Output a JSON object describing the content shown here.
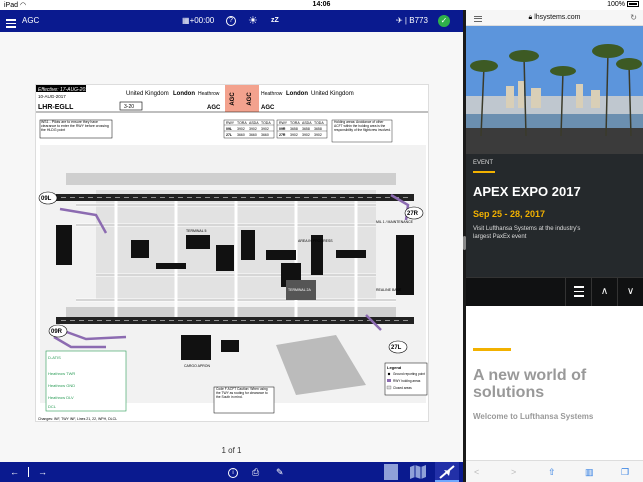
{
  "status_bar": {
    "device": "iPad",
    "wifi_icon": "wifi-icon",
    "time": "14:06",
    "battery": "100%"
  },
  "left_app": {
    "top_bar": {
      "title": "AGC",
      "time_offset": "+00:00",
      "flight": "B773"
    },
    "chart": {
      "effective": "Effective: 17-AUG-2017",
      "date": "10-AUG-2017",
      "airport_code": "LHR-EGLL",
      "country_left": "United Kingdom",
      "city_left": "London",
      "airport_left": "Heathrow",
      "airport_right": "Heathrow",
      "city_right": "London",
      "country_right": "United Kingdom",
      "chart_number": "3-20",
      "chart_type": "AGC",
      "badge_1": "AGC",
      "badge_2": "AGC",
      "note_box": "WS1 - Pilots are to ensure they have clearance to enter the RWY before crossing the HLDG point",
      "holding_note": "Holding areas: Avoidance of other ACFT within the holding area is the responsibility of the flightcrew involved.",
      "runway_table": {
        "headers": [
          "RWY",
          "TORA",
          "ASDA",
          "TODA"
        ],
        "rows": [
          [
            "09L",
            "3902",
            "3902",
            "3902"
          ],
          [
            "27L",
            "3660",
            "3660",
            "3660"
          ],
          [
            "09R",
            "3658",
            "3658",
            "3658"
          ],
          [
            "27R",
            "3902",
            "3902",
            "3902"
          ]
        ]
      },
      "runway_labels": [
        "09L",
        "27R",
        "09R",
        "27L"
      ],
      "terminal_labels": [
        "TERMINAL 2A",
        "TERMINAL 5",
        "CARGO APRON",
        "AREA IN PROGRESS",
        "REALINE BASE",
        "MIL 1 / MAINTENANCE"
      ],
      "legend_title": "Legend",
      "legend_items": [
        "Ground reporting point",
        "RWY holding areas",
        "Closed areas"
      ],
      "caution_text": "Code F ACFT Caution: When using the TWY as routing for clearance to the South in mind.",
      "frequencies": [
        "D-ATIS",
        "Heathrow TWR",
        "Heathrow GND",
        "Heathrow DLV",
        "DCL"
      ],
      "changes": "Changes: INF, TWY INF, Lines 21, 22, WPH, DLCL"
    },
    "page_indicator": "1 of 1"
  },
  "right_app": {
    "url": "lhsystems.com",
    "event": {
      "label": "EVENT",
      "title": "APEX EXPO 2017",
      "date": "Sep 25 - 28, 2017",
      "text": "Visit Lufthansa Systems at the industry's largest PaxEx event"
    },
    "promo": {
      "title": "A new world of solutions",
      "subtitle": "Welcome to Lufthansa Systems"
    }
  },
  "colors": {
    "app_bar": "#0a1a8f",
    "accent_yellow": "#f2b100",
    "event_bg": "#25292c",
    "check_green": "#2fb24a"
  }
}
